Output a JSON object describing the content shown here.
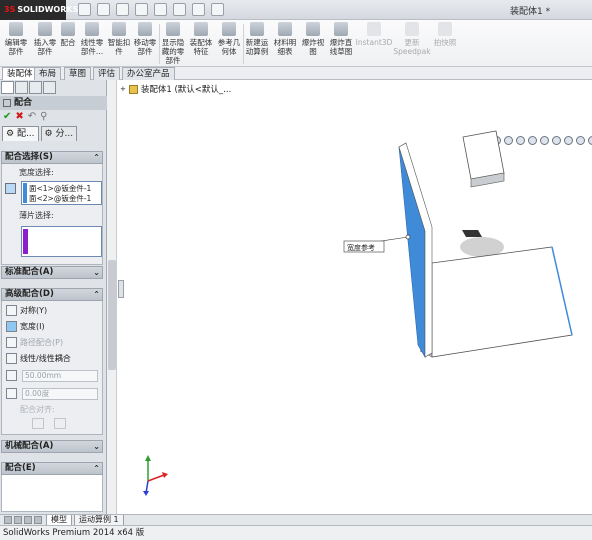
{
  "app": {
    "logo": "SOLIDWORKS",
    "document_title": "装配体1 *"
  },
  "ribbon": {
    "buttons": [
      {
        "label1": "编辑零",
        "label2": "部件"
      },
      {
        "label1": "插入零",
        "label2": "部件"
      },
      {
        "label1": "配合",
        "label2": ""
      },
      {
        "label1": "线性零",
        "label2": "部件..."
      },
      {
        "label1": "智能扣",
        "label2": "件"
      },
      {
        "label1": "移动零",
        "label2": "部件"
      },
      {
        "label1": "显示隐",
        "label2": "藏的零",
        "label3": "部件"
      },
      {
        "label1": "装配体",
        "label2": "特征"
      },
      {
        "label1": "参考几",
        "label2": "何体"
      },
      {
        "label1": "新建运",
        "label2": "动算例"
      },
      {
        "label1": "材料明",
        "label2": "细表"
      },
      {
        "label1": "爆炸视",
        "label2": "图"
      },
      {
        "label1": "爆炸直",
        "label2": "线草图"
      },
      {
        "label1": "Instant3D",
        "label2": ""
      },
      {
        "label1": "更新",
        "label2": "Speedpak"
      },
      {
        "label1": "拍快照",
        "label2": ""
      }
    ]
  },
  "command_tabs": [
    "装配体",
    "布局",
    "草图",
    "评估",
    "办公室产品"
  ],
  "property_manager": {
    "title": "配合",
    "subtabs": [
      "配...",
      "分..."
    ],
    "mate_selections": {
      "header": "配合选择(S)",
      "width_label": "宽度选择:",
      "width_items": [
        "面<1>@钣金件-1",
        "面<2>@钣金件-1"
      ],
      "tab_label": "薄片选择:"
    },
    "standard": "标准配合(A)",
    "advanced": {
      "header": "高级配合(D)",
      "items": [
        "对称(Y)",
        "宽度(I)",
        "路径配合(P)",
        "线性/线性耦合"
      ],
      "distance_value": "50.00mm",
      "angle_value": "0.00度",
      "alignment_label": "配合对齐:"
    },
    "mechanical": "机械配合(A)",
    "mates": "配合(E)"
  },
  "tree": {
    "root": "装配体1  (默认<默认_..."
  },
  "viewport": {
    "callout": "宽度参考"
  },
  "bottom_tabs": [
    "模型",
    "运动算例 1"
  ],
  "status": "SolidWorks Premium 2014 x64 版",
  "colors": {
    "selection_blue": "#3f8bd8",
    "purple_selection": "#8a1fd0",
    "header_gray": "#c7cdd5"
  }
}
